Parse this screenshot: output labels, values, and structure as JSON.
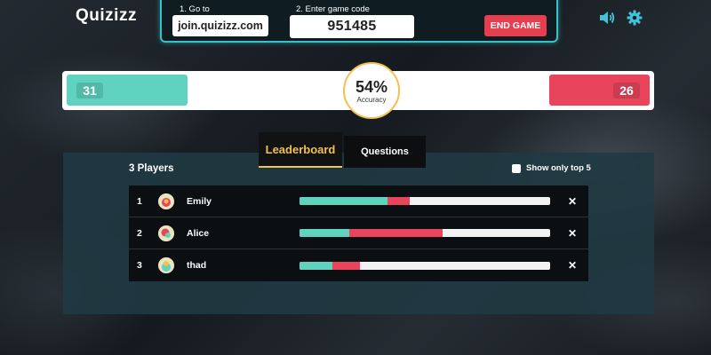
{
  "header": {
    "logo": "Quizizz",
    "step1_label": "1. Go to",
    "url": "join.quizizz.com",
    "step2_label": "2. Enter game code",
    "game_code": "951485",
    "end_game_label": "END GAME",
    "sound_icon": "speaker-icon",
    "settings_icon": "gear-icon"
  },
  "accuracy": {
    "correct_count": "31",
    "incorrect_count": "26",
    "percent": "54%",
    "label": "Accuracy"
  },
  "tabs": [
    {
      "label": "Leaderboard",
      "active": true
    },
    {
      "label": "Questions",
      "active": false
    }
  ],
  "leaderboard": {
    "players_count": "3 Players",
    "show_top5_label": "Show only top 5",
    "show_top5_checked": false,
    "rows": [
      {
        "rank": "1",
        "name": "Emily",
        "correct_fraction": 0.35,
        "incorrect_fraction": 0.09
      },
      {
        "rank": "2",
        "name": "Alice",
        "correct_fraction": 0.2,
        "incorrect_fraction": 0.37
      },
      {
        "rank": "3",
        "name": "thad",
        "correct_fraction": 0.13,
        "incorrect_fraction": 0.11
      }
    ]
  },
  "colors": {
    "correct": "#5fd2c0",
    "incorrect": "#e8455c",
    "accent": "#f2c14e",
    "end_button": "#e63e4e",
    "join_border": "#39c1c7"
  }
}
